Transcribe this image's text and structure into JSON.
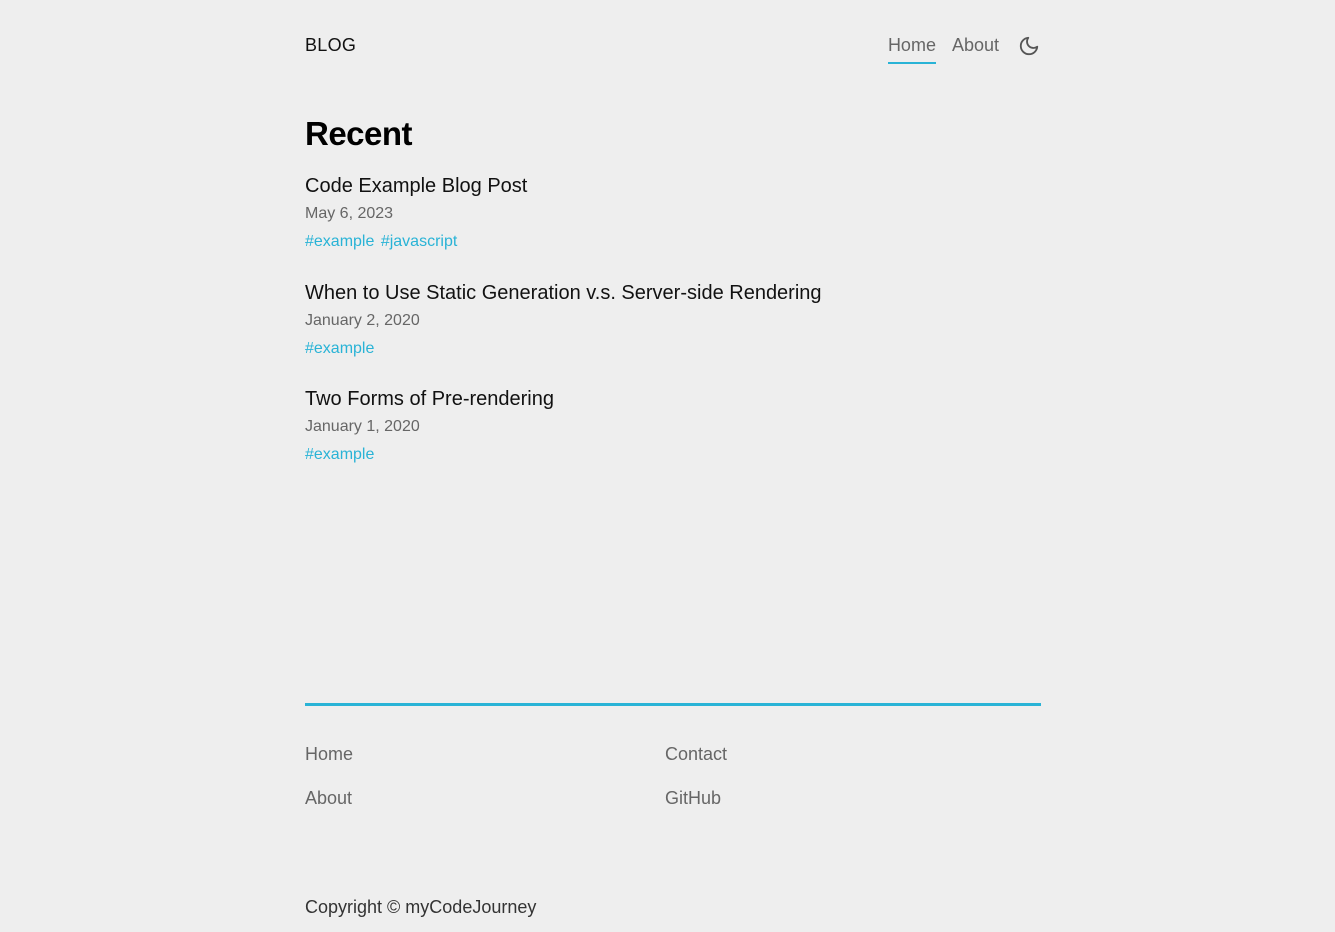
{
  "header": {
    "brand": "BLOG",
    "nav": {
      "home": "Home",
      "about": "About"
    },
    "theme_toggle_icon": "moon-icon"
  },
  "main": {
    "section_title": "Recent",
    "posts": [
      {
        "title": "Code Example Blog Post",
        "date": "May 6, 2023",
        "tags": [
          "#example",
          "#javascript"
        ]
      },
      {
        "title": "When to Use Static Generation v.s. Server-side Rendering",
        "date": "January 2, 2020",
        "tags": [
          "#example"
        ]
      },
      {
        "title": "Two Forms of Pre-rendering",
        "date": "January 1, 2020",
        "tags": [
          "#example"
        ]
      }
    ]
  },
  "footer": {
    "links_left": [
      "Home",
      "About"
    ],
    "links_right": [
      "Contact",
      "GitHub"
    ],
    "copyright": "Copyright © myCodeJourney"
  },
  "colors": {
    "accent": "#29b3d6",
    "background": "#eeeeee",
    "muted_text": "#666666"
  }
}
